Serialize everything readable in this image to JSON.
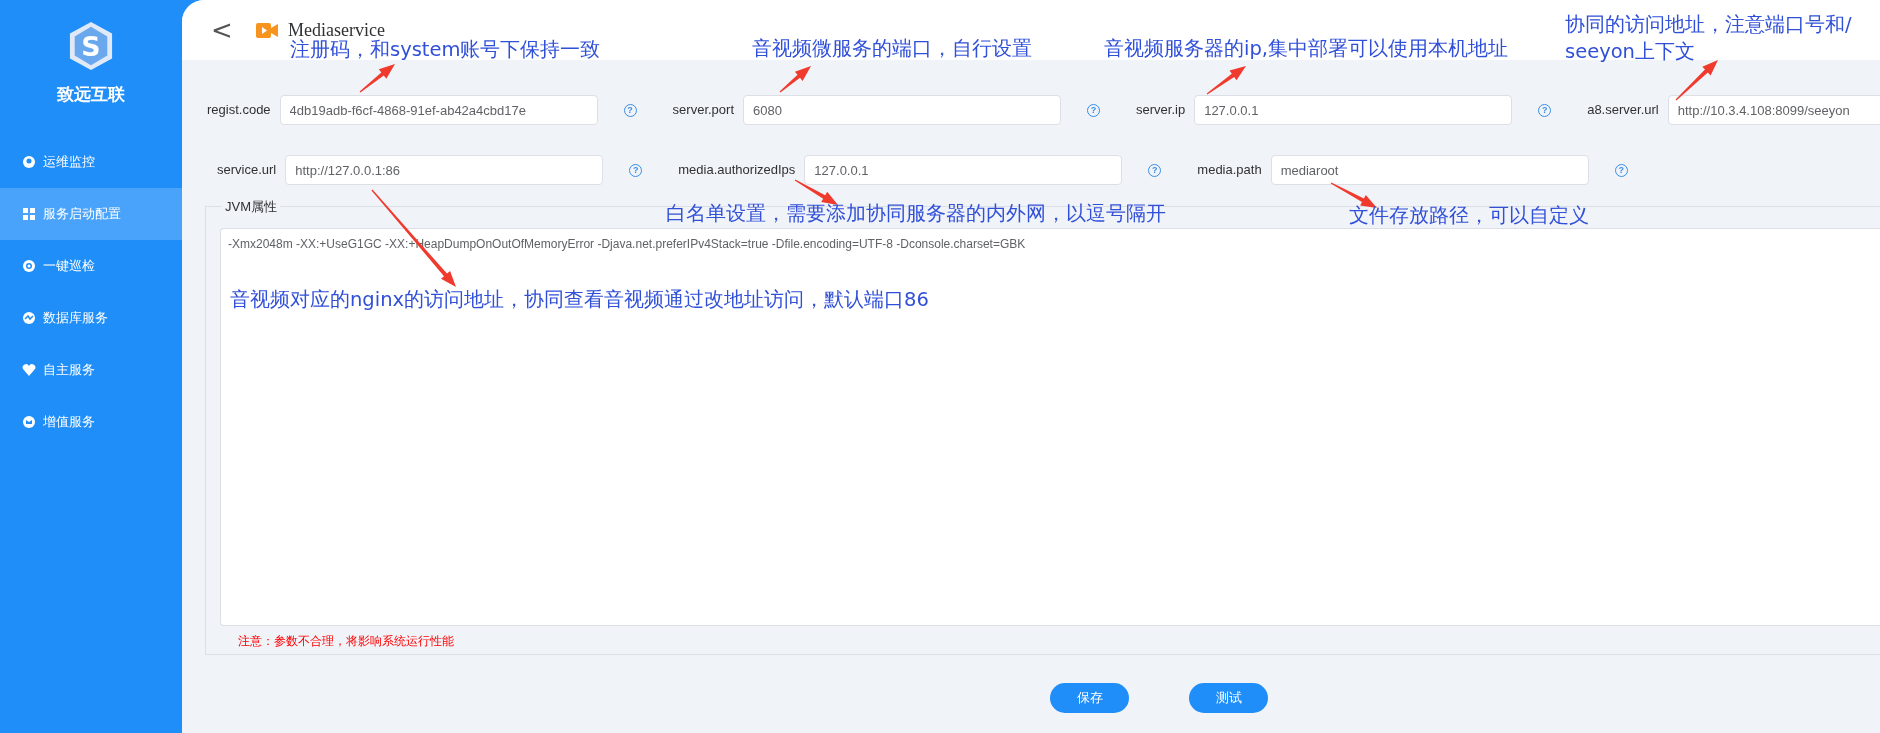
{
  "sidebar": {
    "logo": {
      "mark": "S",
      "name": "致远互联"
    },
    "items": [
      {
        "label": "运维监控",
        "selected": false
      },
      {
        "label": "服务启动配置",
        "selected": true
      },
      {
        "label": "一键巡检",
        "selected": false
      },
      {
        "label": "数据库服务",
        "selected": false
      },
      {
        "label": "自主服务",
        "selected": false
      },
      {
        "label": "增值服务",
        "selected": false
      }
    ]
  },
  "header": {
    "back": "<",
    "title": "Mediaservice"
  },
  "form": {
    "rows": [
      [
        {
          "label": "regist.code",
          "value": "4db19adb-f6cf-4868-91ef-ab42a4cbd17e",
          "help": "?"
        },
        {
          "label": "server.port",
          "value": "6080",
          "help": "?"
        },
        {
          "label": "server.ip",
          "value": "127.0.0.1",
          "help": "?"
        },
        {
          "label": "a8.server.url",
          "value": "http://10.3.4.108:8099/seeyon"
        }
      ],
      [
        {
          "label": "service.url",
          "value": "http://127.0.0.1:86",
          "help": "?"
        },
        {
          "label": "media.authorizedIps",
          "value": "127.0.0.1",
          "help": "?"
        },
        {
          "label": "media.path",
          "value": "mediaroot",
          "help": "?"
        }
      ]
    ]
  },
  "jvm": {
    "legend": "JVM属性",
    "value": "-Xmx2048m -XX:+UseG1GC -XX:+HeapDumpOnOutOfMemoryError -Djava.net.preferIPv4Stack=true -Dfile.encoding=UTF-8 -Dconsole.charset=GBK",
    "note": "注意：参数不合理，将影响系统运行性能"
  },
  "buttons": [
    "保存",
    "测试"
  ],
  "annotations": [
    {
      "text": "注册码，和system账号下保持一致"
    },
    {
      "text": "音视频微服务的端口，自行设置"
    },
    {
      "text": "音视频服务器的ip,集中部署可以使用本机地址"
    },
    {
      "text": "协同的访问地址，注意端口号和/\nseeyon上下文"
    },
    {
      "text": "白名单设置，需要添加协同服务器的内外网，以逗号隔开"
    },
    {
      "text": "文件存放路径，可以自定义"
    },
    {
      "text": "音视频对应的nginx的访问地址，协同查看音视频通过改地址访问，默认端口86"
    }
  ]
}
